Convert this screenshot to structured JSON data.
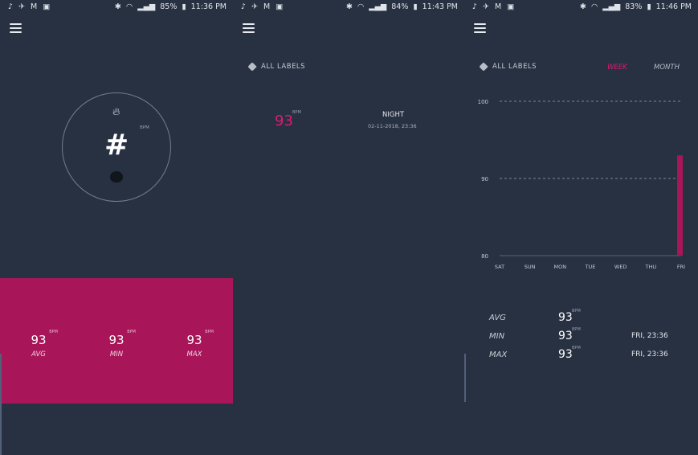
{
  "screens": [
    {
      "status": {
        "battery": "85%",
        "time": "11:36 PM"
      },
      "dial": {
        "glyph": "#",
        "unit": "BPM"
      },
      "summary": [
        {
          "value": "93",
          "unit": "BPM",
          "label": "AVG"
        },
        {
          "value": "93",
          "unit": "BPM",
          "label": "MIN"
        },
        {
          "value": "93",
          "unit": "BPM",
          "label": "MAX"
        }
      ]
    },
    {
      "status": {
        "battery": "84%",
        "time": "11:43 PM"
      },
      "labels_filter": "ALL LABELS",
      "record": {
        "value": "93",
        "unit": "BPM",
        "label": "NIGHT",
        "datetime": "02-11-2018, 23:36"
      }
    },
    {
      "status": {
        "battery": "83%",
        "time": "11:46 PM"
      },
      "labels_filter": "ALL LABELS",
      "segments": {
        "week": "WEEK",
        "month": "MONTH",
        "selected": "week"
      },
      "chart_data": {
        "type": "bar",
        "categories": [
          "SAT",
          "SUN",
          "MON",
          "TUE",
          "WED",
          "THU",
          "FRI"
        ],
        "values": [
          null,
          null,
          null,
          null,
          null,
          null,
          93
        ],
        "y_ticks": [
          "100",
          "90",
          "80"
        ],
        "ylim": [
          80,
          100
        ],
        "grid": true,
        "bar_color": "#a81659"
      },
      "stats": [
        {
          "label": "AVG",
          "value": "93",
          "unit": "BPM",
          "time": ""
        },
        {
          "label": "MIN",
          "value": "93",
          "unit": "BPM",
          "time": "FRI, 23:36"
        },
        {
          "label": "MAX",
          "value": "93",
          "unit": "BPM",
          "time": "FRI, 23:36"
        }
      ]
    }
  ],
  "colors": {
    "background": "#283142",
    "accent": "#e1196f",
    "summary_bg": "#a81659"
  }
}
